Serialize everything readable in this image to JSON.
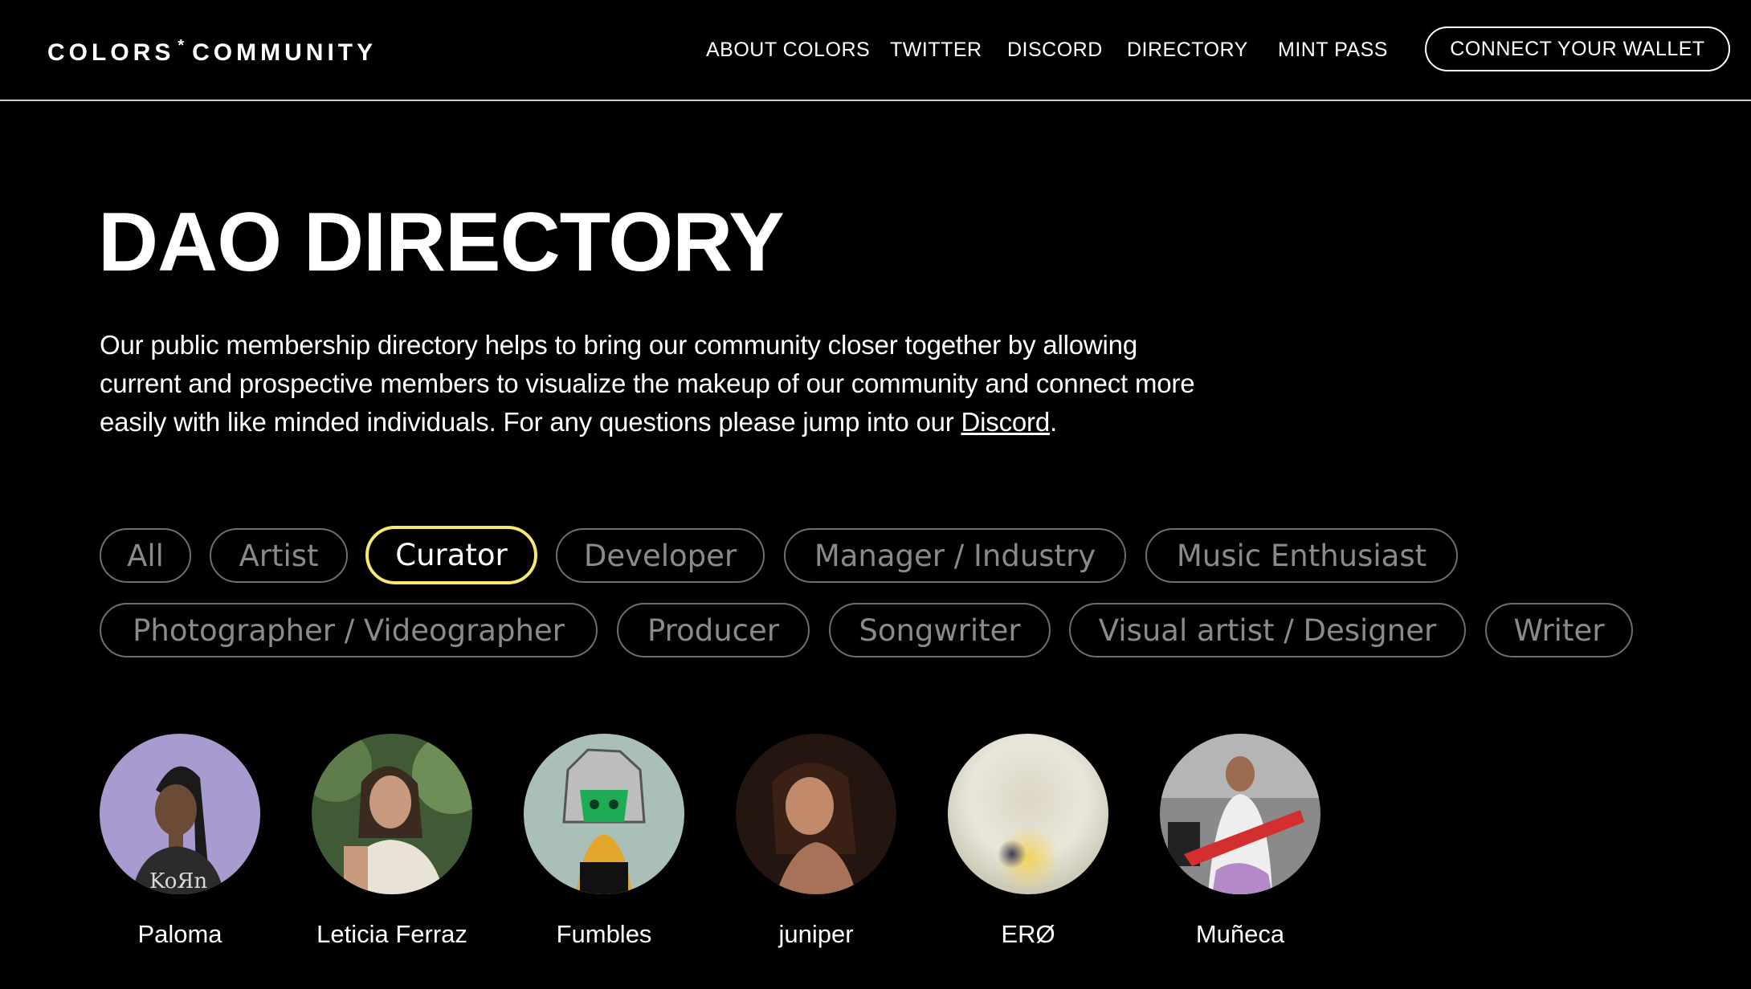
{
  "header": {
    "logo_left": "COLORS",
    "logo_mark": "*",
    "logo_right": "COMMUNITY",
    "nav": {
      "about": "ABOUT COLORS",
      "twitter": "TWITTER",
      "discord": "DISCORD",
      "directory": "DIRECTORY",
      "mint_pass": "MINT PASS"
    },
    "wallet_button": "CONNECT YOUR WALLET"
  },
  "hero": {
    "title": "DAO DIRECTORY",
    "intro_text": "Our public membership directory helps to bring our community closer together by allowing current and prospective members to visualize the makeup of our community and connect more easily with like minded individuals. For any questions please jump into our ",
    "intro_link": "Discord",
    "intro_end": "."
  },
  "filters": {
    "active": "Curator",
    "active_color": "#f5e96e",
    "chips": [
      "All",
      "Artist",
      "Curator",
      "Developer",
      "Manager / Industry",
      "Music Enthusiast",
      "Photographer / Videographer",
      "Producer",
      "Songwriter",
      "Visual artist / Designer",
      "Writer"
    ]
  },
  "members": [
    {
      "name": "Paloma",
      "avatar": "illustrated-avatar"
    },
    {
      "name": "Leticia Ferraz",
      "avatar": "photo-avatar"
    },
    {
      "name": "Fumbles",
      "avatar": "robot-helmet-avatar"
    },
    {
      "name": "juniper",
      "avatar": "photo-avatar"
    },
    {
      "name": "ERØ",
      "avatar": "gradient-avatar"
    },
    {
      "name": "Muñeca",
      "avatar": "photo-avatar"
    }
  ]
}
